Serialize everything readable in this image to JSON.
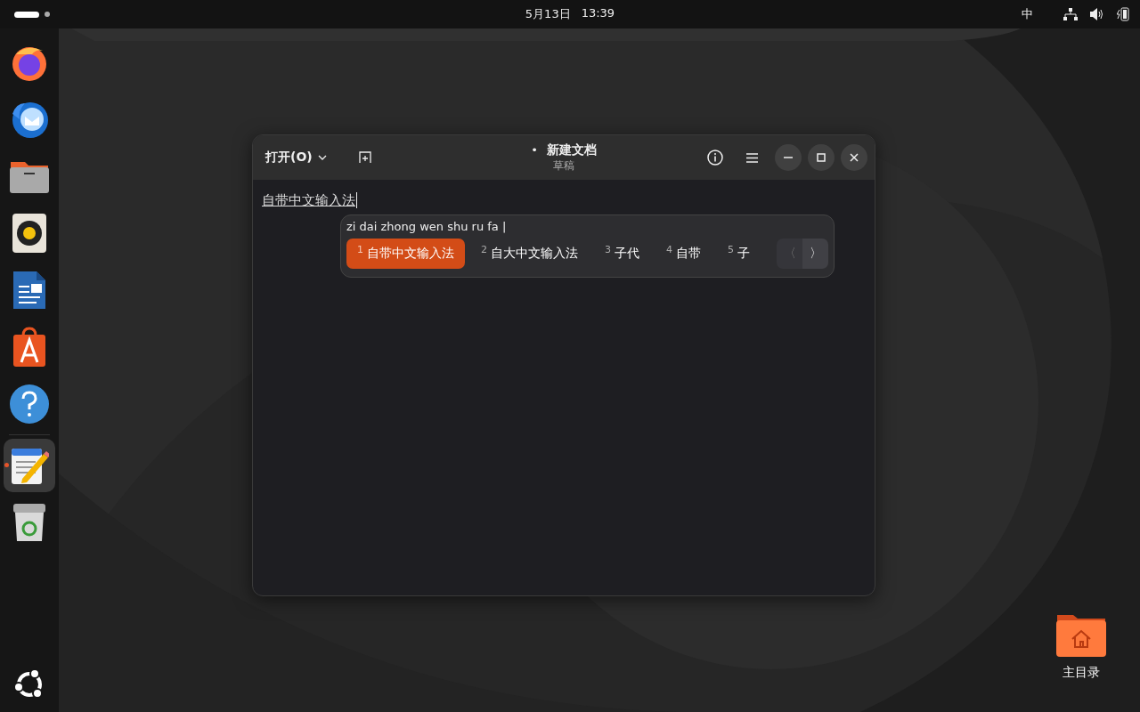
{
  "top_bar": {
    "date": "5月13日",
    "time": "13:39",
    "input_method": "中"
  },
  "dock": {
    "items": [
      {
        "kind": "browser",
        "running": false,
        "selected": false
      },
      {
        "kind": "mail",
        "running": false,
        "selected": false
      },
      {
        "kind": "files",
        "running": false,
        "selected": false
      },
      {
        "kind": "music",
        "running": false,
        "selected": false
      },
      {
        "kind": "writer",
        "running": false,
        "selected": false
      },
      {
        "kind": "store",
        "running": false,
        "selected": false
      },
      {
        "kind": "help",
        "running": false,
        "selected": false
      },
      {
        "kind": "editor",
        "running": true,
        "selected": true
      },
      {
        "kind": "trash",
        "running": false,
        "selected": false
      }
    ]
  },
  "window": {
    "open_button": "打开(O)",
    "title": "新建文档",
    "modified_mark": "•",
    "subtitle": "草稿",
    "document_text": "自带中文输入法"
  },
  "ime": {
    "preedit": "zi dai zhong wen shu ru fa |",
    "candidates": [
      {
        "index": "1",
        "text": "自带中文输入法",
        "selected": true
      },
      {
        "index": "2",
        "text": "自大中文输入法",
        "selected": false
      },
      {
        "index": "3",
        "text": "子代",
        "selected": false
      },
      {
        "index": "4",
        "text": "自带",
        "selected": false
      },
      {
        "index": "5",
        "text": "子",
        "selected": false
      }
    ],
    "prev": {
      "label": "〈",
      "disabled": true
    },
    "next": {
      "label": "〉",
      "disabled": false
    }
  },
  "desktop_icons": [
    {
      "label": "主目录"
    }
  ]
}
